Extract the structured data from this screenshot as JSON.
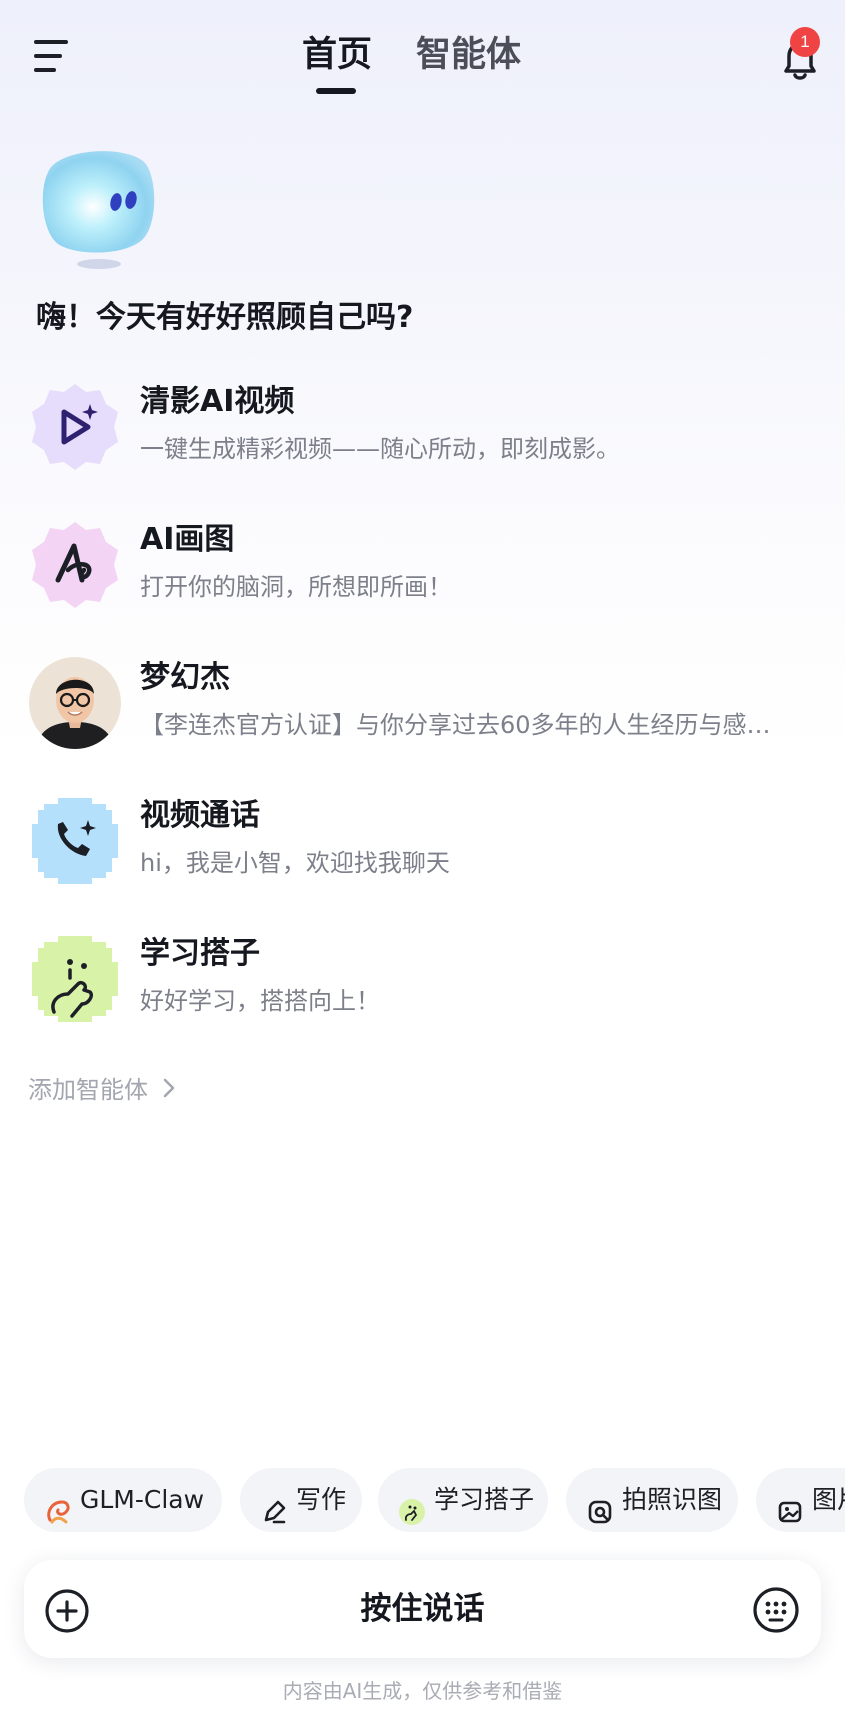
{
  "header": {
    "tabs": [
      {
        "label": "首页",
        "active": true
      },
      {
        "label": "智能体",
        "active": false
      }
    ],
    "notification_count": "1"
  },
  "greeting": "嗨！今天有好好照顾自己吗?",
  "agents": [
    {
      "name": "清影AI视频",
      "desc": "一键生成精彩视频——随心所动，即刻成影。",
      "icon": "video-play-sparkle-icon"
    },
    {
      "name": "AI画图",
      "desc": "打开你的脑洞，所想即所画！",
      "icon": "drawing-pen-icon"
    },
    {
      "name": "梦幻杰",
      "desc": "【李连杰官方认证】与你分享过去60多年的人生经历与感…",
      "icon": "person-avatar"
    },
    {
      "name": "视频通话",
      "desc": "hi，我是小智，欢迎找我聊天",
      "icon": "phone-sparkle-icon"
    },
    {
      "name": "学习搭子",
      "desc": "好好学习，搭搭向上！",
      "icon": "study-buddy-icon"
    }
  ],
  "add_agent": "添加智能体",
  "chips": [
    {
      "label": "GLM-Claw",
      "icon": "claw-icon"
    },
    {
      "label": "写作",
      "icon": "pen-icon"
    },
    {
      "label": "学习搭子",
      "icon": "study-buddy-icon"
    },
    {
      "label": "拍照识图",
      "icon": "camera-scan-icon"
    },
    {
      "label": "图片",
      "icon": "image-icon"
    }
  ],
  "input": {
    "hold_to_talk": "按住说话"
  },
  "disclaimer": "内容由AI生成，仅供参考和借鉴",
  "colors": {
    "badge": "#f04444",
    "video_icon_bg": "#e6dcfb",
    "draw_icon_bg": "#f3d4f4",
    "call_icon_bg": "#b5e0fb",
    "study_icon_bg": "#d8f2a8"
  }
}
